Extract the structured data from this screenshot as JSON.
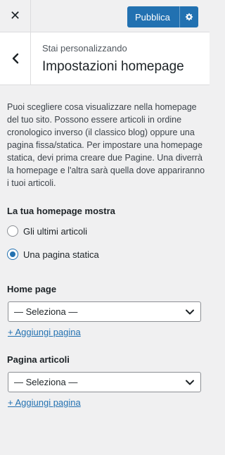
{
  "topbar": {
    "close_icon": "close-icon",
    "publish_label": "Pubblica",
    "settings_icon": "gear-icon"
  },
  "header": {
    "subtitle": "Stai personalizzando",
    "title": "Impostazioni homepage",
    "back_icon": "chevron-left-icon"
  },
  "description": "Puoi scegliere cosa visualizzare nella homepage del tuo sito. Possono essere articoli in ordine cronologico inverso (il classico blog) oppure una pagina fissa/statica. Per impostare una homepage statica, devi prima creare due Pagine. Una diverrà la homepage e l'altra sarà quella dove appariranno i tuoi articoli.",
  "homepage_display": {
    "label": "La tua homepage mostra",
    "options": [
      {
        "label": "Gli ultimi articoli",
        "checked": false
      },
      {
        "label": "Una pagina statica",
        "checked": true
      }
    ]
  },
  "home_page": {
    "label": "Home page",
    "selected": "— Seleziona —",
    "add_link": "+ Aggiungi pagina"
  },
  "posts_page": {
    "label": "Pagina articoli",
    "selected": "— Seleziona —",
    "add_link": "+ Aggiungi pagina"
  },
  "colors": {
    "accent": "#2271b1",
    "background": "#f0f0f1",
    "text": "#1d2327"
  }
}
